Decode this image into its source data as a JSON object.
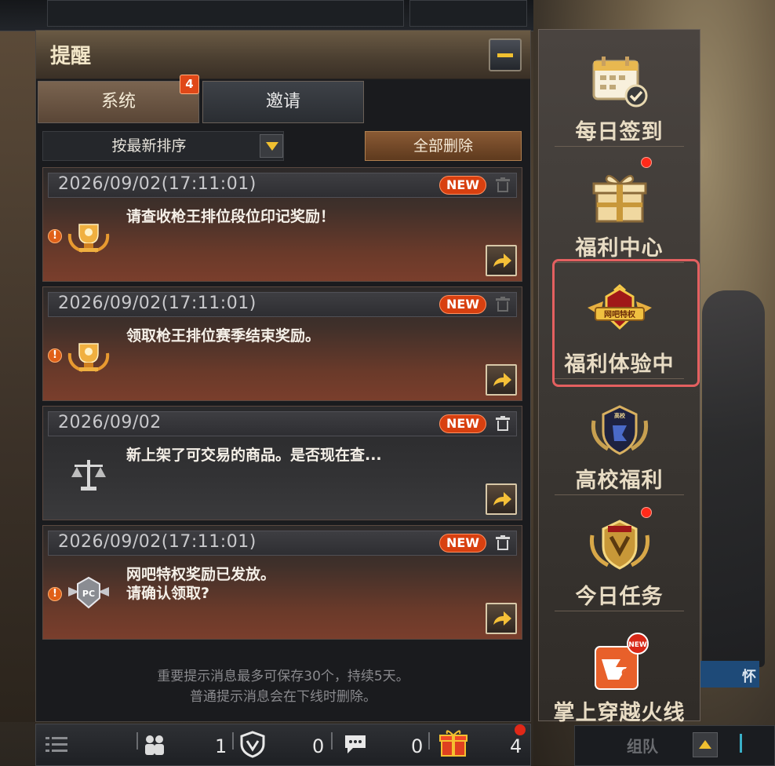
{
  "panel": {
    "title": "提醒",
    "tabs": [
      {
        "label": "系统",
        "badge": "4",
        "active": true
      },
      {
        "label": "邀请",
        "active": false
      }
    ],
    "sort": {
      "selected": "按最新排序"
    },
    "delete_all_label": "全部删除",
    "messages": [
      {
        "date": "2026/09/02(17:11:01)",
        "badge": "NEW",
        "text": "请查收枪王排位段位印记奖励！",
        "icon": "trophy-icon",
        "alert": "!"
      },
      {
        "date": "2026/09/02(17:11:01)",
        "badge": "NEW",
        "text": "领取枪王排位赛季结束奖励。",
        "icon": "trophy-icon",
        "alert": "!"
      },
      {
        "date": "2026/09/02",
        "badge": "NEW",
        "text": "新上架了可交易的商品。是否现在查...",
        "icon": "scales-icon"
      },
      {
        "date": "2026/09/02(17:11:01)",
        "badge": "NEW",
        "text": "网吧特权奖励已发放。\n请确认领取?",
        "icon": "pc-badge-icon",
        "alert": "!"
      }
    ],
    "footer_line1": "重要提示消息最多可保存30个，持续5天。",
    "footer_line2": "普通提示消息会在下线时删除。"
  },
  "bottom_bar": {
    "friends_count": "1",
    "clan_count": "0",
    "chat_count": "0",
    "gift_count": "4"
  },
  "sidebar": {
    "items": [
      {
        "label": "每日签到",
        "icon": "calendar-check-icon",
        "dot": false
      },
      {
        "label": "福利中心",
        "icon": "gift-icon",
        "dot": true
      },
      {
        "label": "福利体验中",
        "icon": "netbar-privilege-icon",
        "dot": false,
        "highlighted": true
      },
      {
        "label": "高校福利",
        "icon": "college-emblem-icon",
        "dot": false
      },
      {
        "label": "今日任务",
        "icon": "mission-emblem-icon",
        "dot": true
      },
      {
        "label": "掌上穿越火线",
        "icon": "cf-mobile-app-icon",
        "dot": false,
        "new_tag": "NEW"
      }
    ]
  },
  "team": {
    "label": "组队"
  },
  "right_strip_text": "怀",
  "colors": {
    "accent": "#f0c030",
    "new_badge": "#d84010",
    "highlight": "#e46060"
  }
}
